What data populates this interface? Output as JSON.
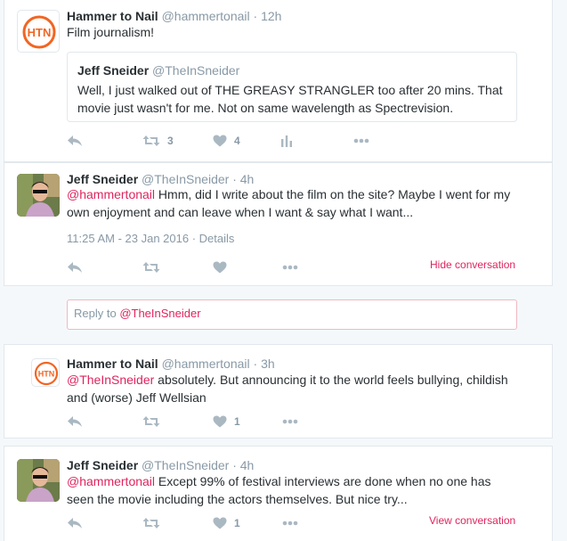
{
  "tweets": [
    {
      "name": "Hammer to Nail",
      "handle": "@hammertonail",
      "time": "· 12h",
      "text": "Film journalism!",
      "quote": {
        "name": "Jeff Sneider",
        "handle": "@TheInSneider",
        "text": "Well, I just walked out of THE GREASY STRANGLER too after 20 mins. That movie just wasn't for me. Not on same wavelength as Spectrevision."
      },
      "retweets": "3",
      "likes": "4"
    },
    {
      "name": "Jeff Sneider",
      "handle": "@TheInSneider",
      "time": "· 4h",
      "mention": "@hammertonail",
      "text": " Hmm, did I write about the film on the site? Maybe I went for my own enjoyment and can leave when I want & say what I want...",
      "timestamp": "11:25 AM - 23 Jan 2016",
      "details": "· Details",
      "conversation_link": "Hide conversation"
    },
    {
      "name": "Hammer to Nail",
      "handle": "@hammertonail",
      "time": "· 3h",
      "mention": "@TheInSneider",
      "text": " absolutely. But announcing it to the world feels bullying, childish and (worse) Jeff Wellsian",
      "likes": "1"
    },
    {
      "name": "Jeff Sneider",
      "handle": "@TheInSneider",
      "time": "· 4h",
      "mention": "@hammertonail",
      "text": " Except 99% of festival interviews are done when no one has seen the movie including the actors themselves. But nice try...",
      "likes": "1",
      "conversation_link": "View conversation"
    }
  ],
  "reply_box": {
    "prefix": "Reply to ",
    "mention": "@TheInSneider"
  },
  "logo": {
    "text": "HTN"
  },
  "colors": {
    "accent": "#e0245e",
    "logo": "#f26522",
    "icon": "#aab8c2"
  }
}
